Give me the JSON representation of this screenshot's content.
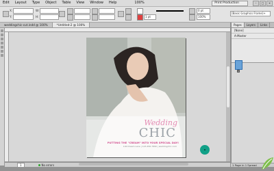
{
  "menu": [
    "Edit",
    "Layout",
    "Type",
    "Object",
    "Table",
    "View",
    "Window",
    "Help"
  ],
  "app": {
    "zoom": "100%",
    "workspace": "Print Production",
    "paragraph_style": "[Basic Graphics Frame]+"
  },
  "control_panel": {
    "x_value": "",
    "y_value": "",
    "w_value": "",
    "h_value": "",
    "stroke_weight": "1 pt",
    "opacity": "100%",
    "fx_value": "0 pt"
  },
  "tabs": [
    {
      "label": "weddingchic-cut.indd @ 100%",
      "active": false
    },
    {
      "label": "*Untitled-2 @ 100%",
      "active": true
    }
  ],
  "status": {
    "page": "1",
    "errors": "No errors"
  },
  "pages_panel": {
    "tabs": [
      "Pages",
      "Layers",
      "Links"
    ],
    "none_master": "[None]",
    "a_master": "A-Master",
    "page_number": "1",
    "footer": "1 Page in 1 Spread"
  },
  "document": {
    "title_script": "Wedding",
    "title_main": "CHIC",
    "tagline": "PUTTING THE \"CREAM\" INTO YOUR SPECIAL DAY!",
    "contact": "100 Dream Lane | 123-456-7890 | weddingchic.com"
  },
  "colors": {
    "accent": "#11a087",
    "pink": "#e48bb3",
    "tagline": "#d2508f"
  }
}
